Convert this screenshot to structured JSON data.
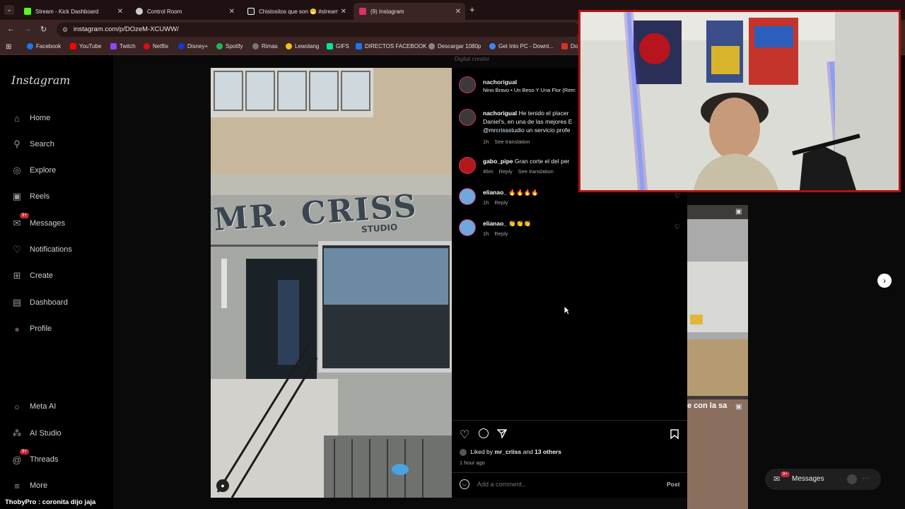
{
  "browser": {
    "tabs": [
      {
        "label": "Stream - Kick Dashboard",
        "color": "#53fc18"
      },
      {
        "label": "Control Room",
        "color": "#cccccc"
      },
      {
        "label": "Chistositos que son 😁 #stream",
        "color": "#ffffff"
      },
      {
        "label": "(9) Instagram",
        "color": "#e1306c"
      }
    ],
    "url": "instagram.com/p/DOzeM-XCUWW/",
    "bookmarks": [
      {
        "label": "Facebook",
        "color": "#1877f2"
      },
      {
        "label": "YouTube",
        "color": "#ff0000"
      },
      {
        "label": "Twitch",
        "color": "#9146ff"
      },
      {
        "label": "Netflix",
        "color": "#e50914"
      },
      {
        "label": "Disney+",
        "color": "#113ccf"
      },
      {
        "label": "Spotify",
        "color": "#1db954"
      },
      {
        "label": "Rimas",
        "color": "#777777"
      },
      {
        "label": "Lewolang",
        "color": "#f4c20d"
      },
      {
        "label": "GIFS",
        "color": "#00e5a0"
      },
      {
        "label": "DIRECTOS FACEBOOK",
        "color": "#1877f2"
      },
      {
        "label": "Descargar 1080p",
        "color": "#888888"
      },
      {
        "label": "Get Into PC - Downl...",
        "color": "#4285f4"
      },
      {
        "label": "Do",
        "color": "#d93025"
      }
    ]
  },
  "sidebar": {
    "logo": "Instagram",
    "items": [
      {
        "label": "Home",
        "icon": "home-icon",
        "glyph": "⌂"
      },
      {
        "label": "Search",
        "icon": "search-icon",
        "glyph": "⚲"
      },
      {
        "label": "Explore",
        "icon": "explore-icon",
        "glyph": "◎"
      },
      {
        "label": "Reels",
        "icon": "reels-icon",
        "glyph": "▣"
      },
      {
        "label": "Messages",
        "icon": "messages-icon",
        "glyph": "✉",
        "badge": "9+"
      },
      {
        "label": "Notifications",
        "icon": "heart-icon",
        "glyph": "♡"
      },
      {
        "label": "Create",
        "icon": "plus-icon",
        "glyph": "⊞"
      },
      {
        "label": "Dashboard",
        "icon": "dashboard-icon",
        "glyph": "▤"
      },
      {
        "label": "Profile",
        "icon": "profile-icon",
        "glyph": "●"
      }
    ],
    "bottom_items": [
      {
        "label": "Meta AI",
        "icon": "meta-ai-icon",
        "glyph": "○"
      },
      {
        "label": "AI Studio",
        "icon": "ai-studio-icon",
        "glyph": "⁂"
      },
      {
        "label": "Threads",
        "icon": "threads-icon",
        "glyph": "@",
        "badge": "9+"
      },
      {
        "label": "More",
        "icon": "menu-icon",
        "glyph": "≡"
      }
    ]
  },
  "post": {
    "header_name": "nachorigual",
    "header_audio": "Nino Bravo • Un Beso Y Una Flor (Rem",
    "top_label": "Digital creator",
    "sign_text": "MR. CRISS",
    "sign_sub": "STUDIO",
    "comments": [
      {
        "user": "nachorigual",
        "text": "He tenido el placer Daniel's, en una de las mejores E",
        "mention": "@mrcrissstudio",
        "tail": "un servicio profe",
        "time": "1h",
        "actions": [
          "See translation"
        ]
      },
      {
        "user": "gabo_pipe",
        "text": "Gran corte el del per",
        "time": "46m",
        "actions": [
          "Reply",
          "See translation"
        ]
      },
      {
        "user": "elianao_",
        "text": "🔥🔥🔥🔥",
        "time": "1h",
        "actions": [
          "Reply"
        ]
      },
      {
        "user": "elianao_",
        "text": "👏👏👏",
        "time": "1h",
        "actions": [
          "Reply"
        ]
      }
    ],
    "liked_prefix": "Liked by",
    "liked_user": "mr_criiss",
    "liked_and": "and",
    "liked_others": "13 others",
    "time_ago": "1 hour ago",
    "comment_placeholder": "Add a comment...",
    "post_button": "Post"
  },
  "background": {
    "thumb_caption": "e con la sa"
  },
  "messages_pill": {
    "label": "Messages",
    "badge": "9+"
  },
  "chat": {
    "user": "ThobyPro",
    "message": "coronita dijo jaja"
  }
}
